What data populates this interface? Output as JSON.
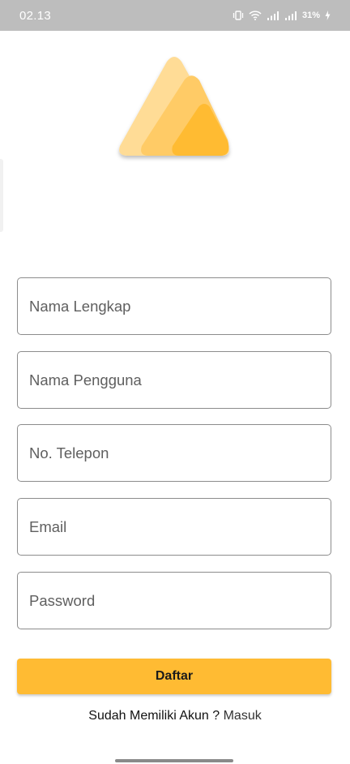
{
  "status_bar": {
    "time": "02.13",
    "battery": "31%",
    "icons": [
      "vibrate-icon",
      "wifi-icon",
      "signal-icon",
      "signal-icon",
      "battery-charging-icon"
    ]
  },
  "logo": {
    "icon": "triangle-logo-icon",
    "colors": [
      "#ffdc96",
      "#ffcb66",
      "#ffbb33"
    ]
  },
  "form": {
    "full_name_placeholder": "Nama Lengkap",
    "username_placeholder": "Nama Pengguna",
    "phone_placeholder": "No. Telepon",
    "email_placeholder": "Email",
    "password_placeholder": "Password"
  },
  "register_button_label": "Daftar",
  "login_prompt": {
    "text": "Sudah Memiliki Akun ? ",
    "link": "Masuk"
  },
  "colors": {
    "accent": "#ffbb33",
    "status_bar": "#bdbdbd"
  }
}
